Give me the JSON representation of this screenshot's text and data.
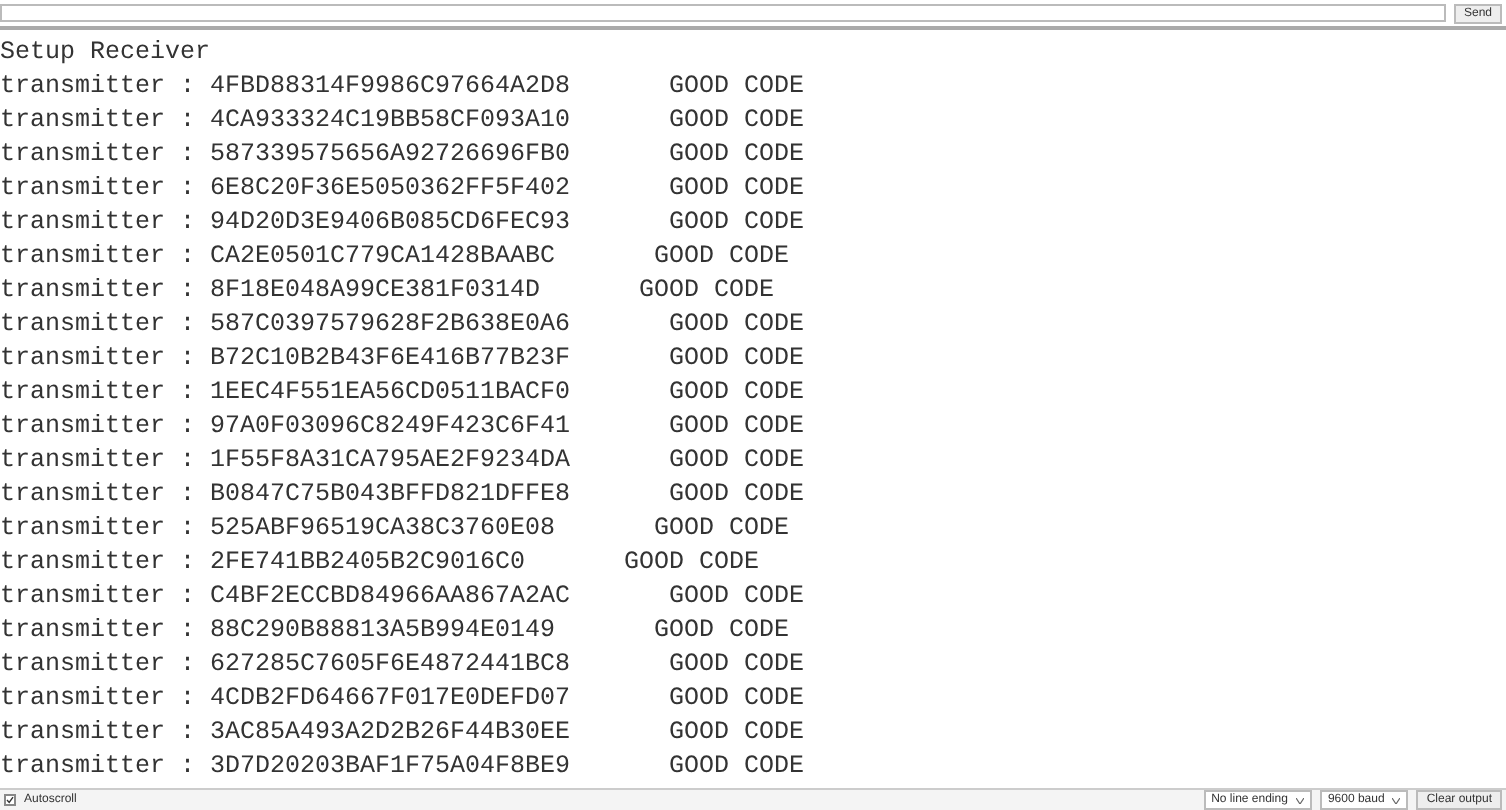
{
  "send_bar": {
    "send_button": "Send"
  },
  "output": {
    "header": "Setup Receiver",
    "lines": [
      {
        "text": "transmitter : 4FBD88314F9986C97664A2D8",
        "status": "GOOD CODE"
      },
      {
        "text": "transmitter : 4CA933324C19BB58CF093A10",
        "status": "GOOD CODE"
      },
      {
        "text": "transmitter : 587339575656A92726696FB0",
        "status": "GOOD CODE"
      },
      {
        "text": "transmitter : 6E8C20F36E5050362FF5F402",
        "status": "GOOD CODE"
      },
      {
        "text": "transmitter : 94D20D3E9406B085CD6FEC93",
        "status": "GOOD CODE"
      },
      {
        "text": "transmitter : CA2E0501C779CA1428BAABC",
        "status": "GOOD CODE"
      },
      {
        "text": "transmitter : 8F18E048A99CE381F0314D",
        "status": "GOOD CODE"
      },
      {
        "text": "transmitter : 587C0397579628F2B638E0A6",
        "status": "GOOD CODE"
      },
      {
        "text": "transmitter : B72C10B2B43F6E416B77B23F",
        "status": "GOOD CODE"
      },
      {
        "text": "transmitter : 1EEC4F551EA56CD0511BACF0",
        "status": "GOOD CODE"
      },
      {
        "text": "transmitter : 97A0F03096C8249F423C6F41",
        "status": "GOOD CODE"
      },
      {
        "text": "transmitter : 1F55F8A31CA795AE2F9234DA",
        "status": "GOOD CODE"
      },
      {
        "text": "transmitter : B0847C75B043BFFD821DFFE8",
        "status": "GOOD CODE"
      },
      {
        "text": "transmitter : 525ABF96519CA38C3760E08",
        "status": "GOOD CODE"
      },
      {
        "text": "transmitter : 2FE741BB2405B2C9016C0",
        "status": "GOOD CODE"
      },
      {
        "text": "transmitter : C4BF2ECCBD84966AA867A2AC",
        "status": "GOOD CODE"
      },
      {
        "text": "transmitter : 88C290B88813A5B994E0149",
        "status": "GOOD CODE"
      },
      {
        "text": "transmitter : 627285C7605F6E4872441BC8",
        "status": "GOOD CODE"
      },
      {
        "text": "transmitter : 4CDB2FD64667F017E0DEFD07",
        "status": "GOOD CODE"
      },
      {
        "text": "transmitter : 3AC85A493A2D2B26F44B30EE",
        "status": "GOOD CODE"
      },
      {
        "text": "transmitter : 3D7D20203BAF1F75A04F8BE9",
        "status": "GOOD CODE"
      }
    ]
  },
  "bottom_bar": {
    "autoscroll": {
      "label": "Autoscroll",
      "checked": true
    },
    "line_ending": "No line ending",
    "baud": "9600 baud",
    "clear_button": "Clear output"
  }
}
